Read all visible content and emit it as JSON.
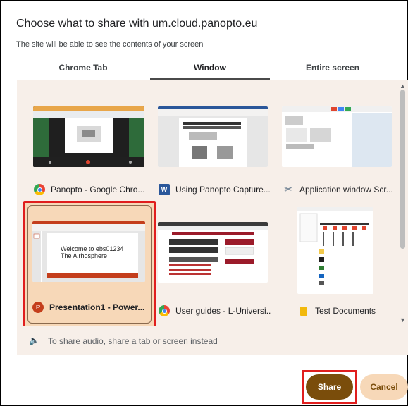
{
  "dialog": {
    "title": "Choose what to share with um.cloud.panopto.eu",
    "subtitle": "The site will be able to see the contents of your screen"
  },
  "tabs": [
    {
      "label": "Chrome Tab",
      "active": false
    },
    {
      "label": "Window",
      "active": true
    },
    {
      "label": "Entire screen",
      "active": false
    }
  ],
  "windows": [
    {
      "label": "Panopto - Google Chro...",
      "icon": "chrome-icon",
      "selected": false
    },
    {
      "label": "Using Panopto Capture....",
      "icon": "word-icon",
      "selected": false
    },
    {
      "label": "Application window Scr...",
      "icon": "snipping-tool-icon",
      "selected": false
    },
    {
      "label": "Presentation1 - Power...",
      "icon": "powerpoint-icon",
      "selected": true,
      "preview_text": "Welcome to ebs01234 The A rhosphere"
    },
    {
      "label": "User guides - L-Universi...",
      "icon": "chrome-icon",
      "selected": false
    },
    {
      "label": "Test Documents",
      "icon": "folder-icon",
      "selected": false
    }
  ],
  "audio_note": "To share audio, share a tab or screen instead",
  "buttons": {
    "share": "Share",
    "cancel": "Cancel"
  },
  "colors": {
    "accent": "#7a4d0b",
    "selection_fill": "#f7d8b8",
    "highlight_box": "#e01e1e",
    "grid_background": "#f7efe9"
  }
}
